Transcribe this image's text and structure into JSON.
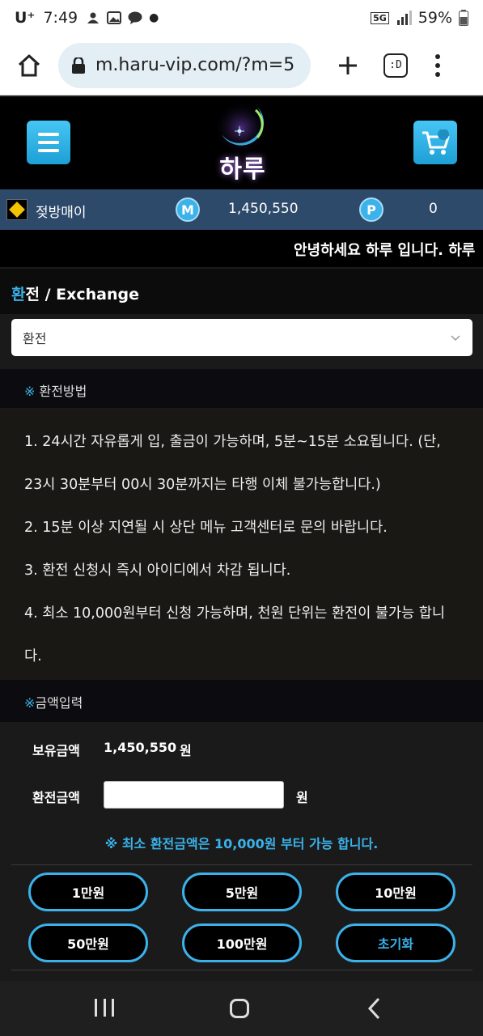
{
  "status_bar": {
    "carrier": "U⁺",
    "time": "7:49",
    "network": "5G",
    "battery": "59%"
  },
  "browser": {
    "url": "m.haru-vip.com/?m=5",
    "tabs_label": ":D"
  },
  "header": {
    "logo_text": "하루"
  },
  "member": {
    "username": "젖방매이",
    "money_badge": "M",
    "money": "1,450,550",
    "point_badge": "P",
    "points": "0"
  },
  "marquee_text": "안녕하세요 하루 입니다. 하루",
  "page_title": {
    "accent": "환",
    "rest": "전 / Exchange"
  },
  "select": {
    "value": "환전"
  },
  "howto": {
    "mark": "※",
    "title": " 환전방법",
    "lines": [
      "1. 24시간 자유롭게 입, 출금이 가능하며, 5분~15분 소요됩니다. (단, 23시 30분부터 00시 30분까지는 타행 이체 불가능합니다.)",
      "2. 15분 이상 지연될 시 상단 메뉴 고객센터로 문의 바랍니다.",
      "3. 환전 신청시 즉시 아이디에서 차감 됩니다.",
      "4. 최소 10,000원부터 신청 가능하며, 천원 단위는 환전이 불가능 합니다."
    ]
  },
  "amount_section": {
    "mark": "※",
    "title": "금액입력",
    "balance_label": "보유금액",
    "balance_value": "1,450,550",
    "balance_unit": "원",
    "exchange_label": "환전금액",
    "exchange_value": "",
    "exchange_unit": "원",
    "notice": "※ 최소 환전금액은 10,000원 부터 가능 합니다."
  },
  "amount_buttons": [
    "1만원",
    "5만원",
    "10만원",
    "50만원",
    "100만원",
    "초기화"
  ],
  "colors": {
    "accent": "#3bb2ea",
    "member_bar": "#2d4a6a",
    "page_bg": "#1a1a1a"
  }
}
